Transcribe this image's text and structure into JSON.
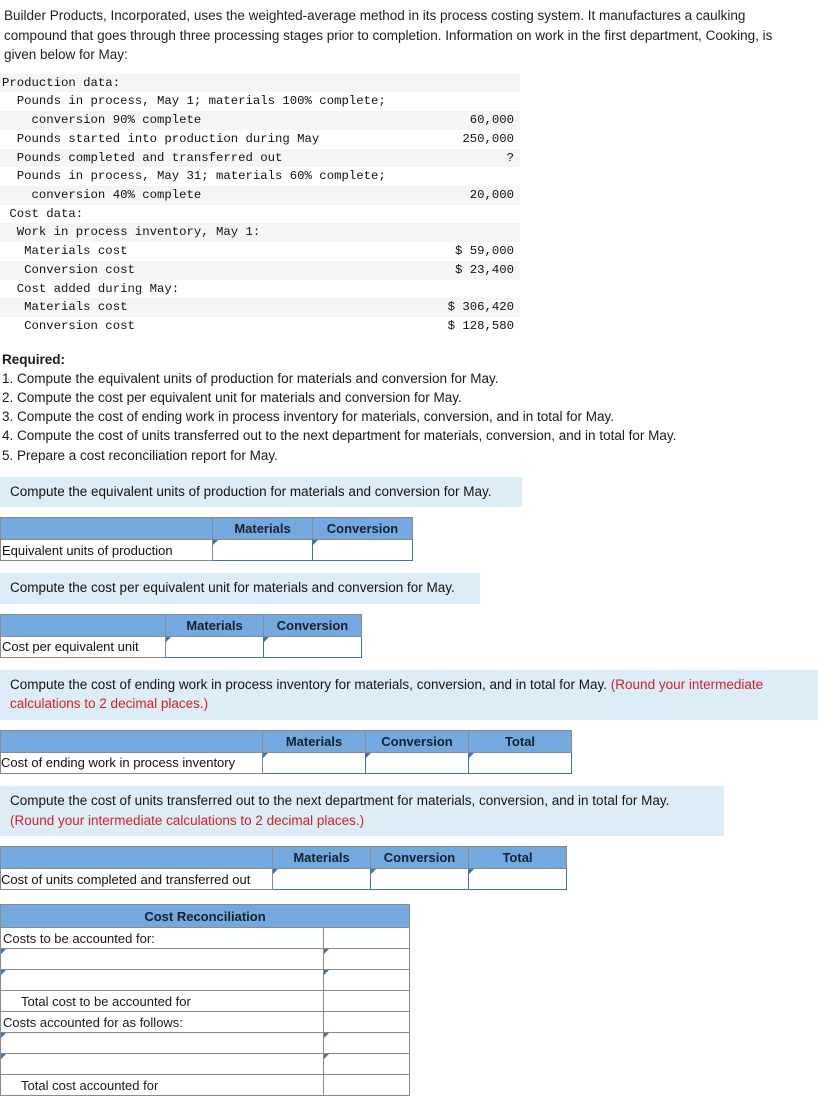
{
  "problem": {
    "statement": "Builder Products, Incorporated, uses the weighted-average method in its process costing system. It manufactures a caulking compound that goes through three processing stages prior to completion. Information on work in the first department, Cooking, is given below for May:"
  },
  "data_table": {
    "rows": [
      {
        "label": "Production data:",
        "value": ""
      },
      {
        "label": "  Pounds in process, May 1; materials 100% complete;",
        "value": ""
      },
      {
        "label": "    conversion 90% complete",
        "value": "60,000"
      },
      {
        "label": "  Pounds started into production during May",
        "value": "250,000"
      },
      {
        "label": "  Pounds completed and transferred out",
        "value": "?"
      },
      {
        "label": "  Pounds in process, May 31; materials 60% complete;",
        "value": ""
      },
      {
        "label": "    conversion 40% complete",
        "value": "20,000"
      },
      {
        "label": " Cost data:",
        "value": ""
      },
      {
        "label": "  Work in process inventory, May 1:",
        "value": ""
      },
      {
        "label": "   Materials cost",
        "value": "$ 59,000"
      },
      {
        "label": "   Conversion cost",
        "value": "$ 23,400"
      },
      {
        "label": "  Cost added during May:",
        "value": ""
      },
      {
        "label": "   Materials cost",
        "value": "$ 306,420"
      },
      {
        "label": "   Conversion cost",
        "value": "$ 128,580"
      }
    ]
  },
  "required": {
    "heading": "Required:",
    "items": [
      "1. Compute the equivalent units of production for materials and conversion for May.",
      "2. Compute the cost per equivalent unit for materials and conversion for May.",
      "3. Compute the cost of ending work in process inventory for materials, conversion, and in total for May.",
      "4. Compute the cost of units transferred out to the next department for materials, conversion, and in total for May.",
      "5. Prepare a cost reconciliation report for May."
    ]
  },
  "sections": [
    {
      "banner": "Compute the equivalent units of production for materials and conversion for May.",
      "banner_warn": "",
      "columns": [
        "",
        "Materials",
        "Conversion"
      ],
      "row_label": "Equivalent units of production",
      "inputs": [
        "",
        ""
      ]
    },
    {
      "banner": "Compute the cost per equivalent unit for materials and conversion for May.",
      "banner_warn": "",
      "columns": [
        "",
        "Materials",
        "Conversion"
      ],
      "row_label": "Cost per equivalent unit",
      "inputs": [
        "",
        ""
      ]
    },
    {
      "banner": "Compute the cost of ending work in process inventory for materials, conversion, and in total for May. ",
      "banner_warn": "(Round your intermediate calculations to 2 decimal places.)",
      "columns": [
        "",
        "Materials",
        "Conversion",
        "Total"
      ],
      "row_label": "Cost of ending work in process inventory",
      "inputs": [
        "",
        "",
        ""
      ]
    },
    {
      "banner": "Compute the cost of units transferred out to the next department for materials, conversion, and in total for May. ",
      "banner_warn": "(Round your intermediate calculations to 2 decimal places.)",
      "columns": [
        "",
        "Materials",
        "Conversion",
        "Total"
      ],
      "row_label": "Cost of units completed and transferred out",
      "inputs": [
        "",
        "",
        ""
      ]
    }
  ],
  "reconciliation": {
    "title": "Cost Reconciliation",
    "rows": [
      {
        "label": "Costs to be accounted for:",
        "kind": "label-plain",
        "value": ""
      },
      {
        "label": "",
        "kind": "input-input",
        "value": ""
      },
      {
        "label": "",
        "kind": "input-input",
        "value": ""
      },
      {
        "label": "Total cost to be accounted for",
        "kind": "indent-total",
        "value": ""
      },
      {
        "label": "Costs accounted for as follows:",
        "kind": "label-plain",
        "value": ""
      },
      {
        "label": "",
        "kind": "input-input",
        "value": ""
      },
      {
        "label": "",
        "kind": "input-input",
        "value": ""
      },
      {
        "label": "Total cost accounted for",
        "kind": "indent-grandtotal",
        "value": ""
      }
    ]
  },
  "colors": {
    "header_blue": "#74a9e0",
    "banner_blue": "#dcedf8",
    "warn_red": "#d61f22",
    "input_border": "#3e74ad"
  }
}
